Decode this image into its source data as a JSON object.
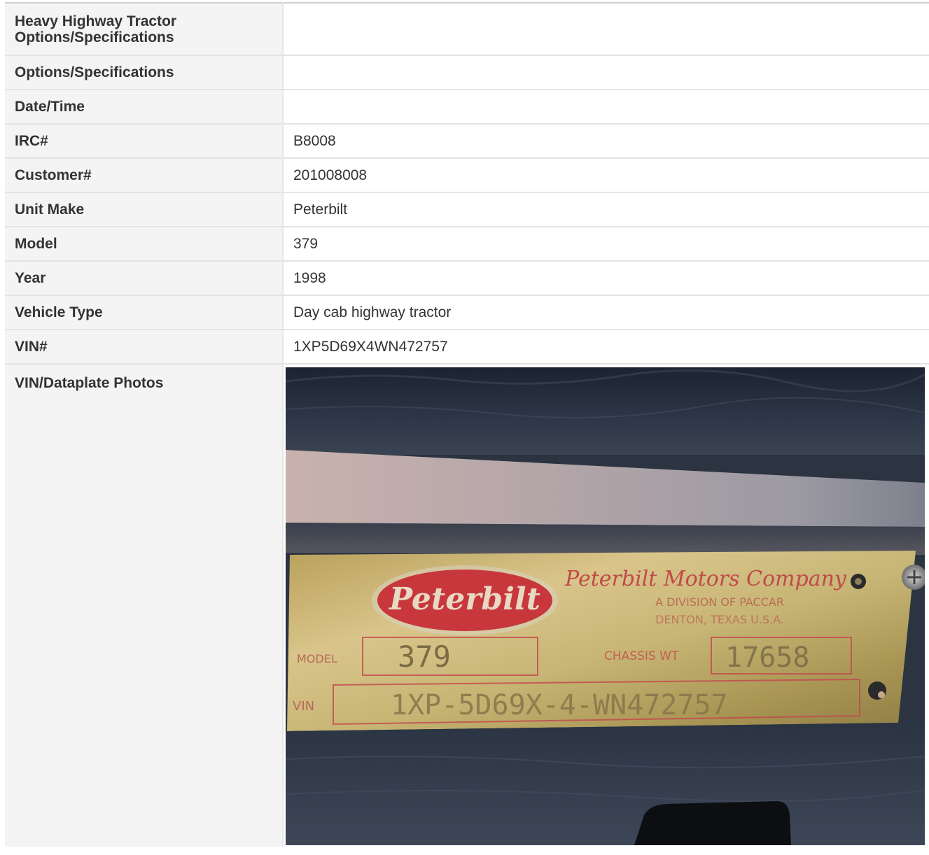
{
  "rows": [
    {
      "label": "Heavy Highway Tractor Options/Specifications",
      "value": ""
    },
    {
      "label": "Options/Specifications",
      "value": ""
    },
    {
      "label": "Date/Time",
      "value": ""
    },
    {
      "label": "IRC#",
      "value": "B8008"
    },
    {
      "label": "Customer#",
      "value": "201008008"
    },
    {
      "label": "Unit Make",
      "value": "Peterbilt"
    },
    {
      "label": "Model",
      "value": "379"
    },
    {
      "label": "Year",
      "value": "1998"
    },
    {
      "label": "Vehicle Type",
      "value": "Day cab highway tractor"
    },
    {
      "label": "VIN#",
      "value": "1XP5D69X4WN472757"
    },
    {
      "label": "VIN/Dataplate Photos",
      "value": ""
    }
  ],
  "photo": {
    "logo": "Peterbilt",
    "company": "Peterbilt Motors Company",
    "division": "A DIVISION OF PACCAR",
    "location": "DENTON, TEXAS U.S.A.",
    "model_label": "MODEL",
    "model_value": "379",
    "chassis_label": "CHASSIS WT",
    "chassis_value": "17658",
    "vin_label": "VIN",
    "vin_value": "1XP-5D69X-4-WN472757"
  }
}
